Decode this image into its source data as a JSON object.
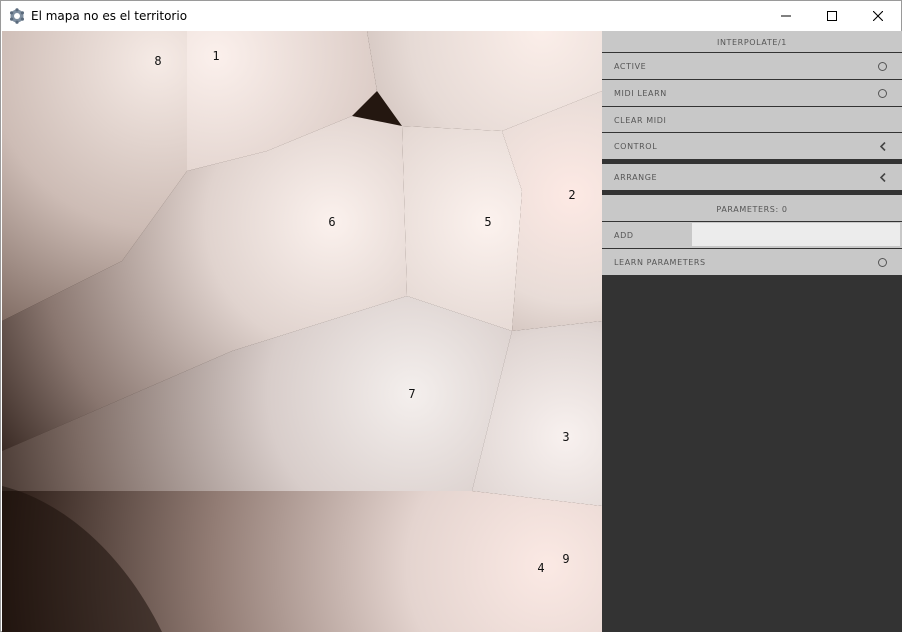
{
  "window": {
    "title": "El mapa no es el territorio",
    "icon": "gear-network-icon"
  },
  "canvas": {
    "points": [
      {
        "id": "1",
        "label": "1"
      },
      {
        "id": "2",
        "label": "2"
      },
      {
        "id": "3",
        "label": "3"
      },
      {
        "id": "4",
        "label": "4"
      },
      {
        "id": "5",
        "label": "5"
      },
      {
        "id": "6",
        "label": "6"
      },
      {
        "id": "7",
        "label": "7"
      },
      {
        "id": "8",
        "label": "8"
      },
      {
        "id": "9",
        "label": "9"
      }
    ]
  },
  "panel": {
    "header": "INTERPOLATE/1",
    "active_label": "ACTIVE",
    "midi_learn_label": "MIDI LEARN",
    "clear_midi_label": "CLEAR MIDI",
    "control_label": "CONTROL",
    "arrange_label": "ARRANGE",
    "parameters_header": "PARAMETERS: 0",
    "add_label": "ADD",
    "add_value": "",
    "learn_parameters_label": "LEARN PARAMETERS"
  },
  "colors": {
    "panel_bg": "#333333",
    "row_bg": "#c8c8c8",
    "cell_light": "#f6e8e2"
  }
}
